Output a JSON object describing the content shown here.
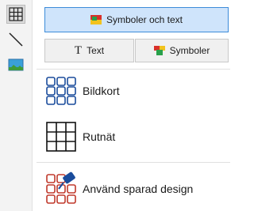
{
  "toolbar": {
    "tools": [
      {
        "icon": "grid-icon",
        "selected": true
      },
      {
        "icon": "line-icon",
        "selected": false
      },
      {
        "icon": "image-icon",
        "selected": false
      }
    ]
  },
  "mode": {
    "main_label": "Symboler och text",
    "text_label": "Text",
    "symbols_label": "Symboler"
  },
  "options": {
    "cards_label": "Bildkort",
    "grid_label": "Rutnät",
    "saved_label": "Använd sparad design"
  },
  "colors": {
    "accent": "#3c8bd9",
    "selected_bg": "#cfe4fb",
    "card_blue": "#1a4c9c",
    "saved_red": "#c0392b"
  }
}
